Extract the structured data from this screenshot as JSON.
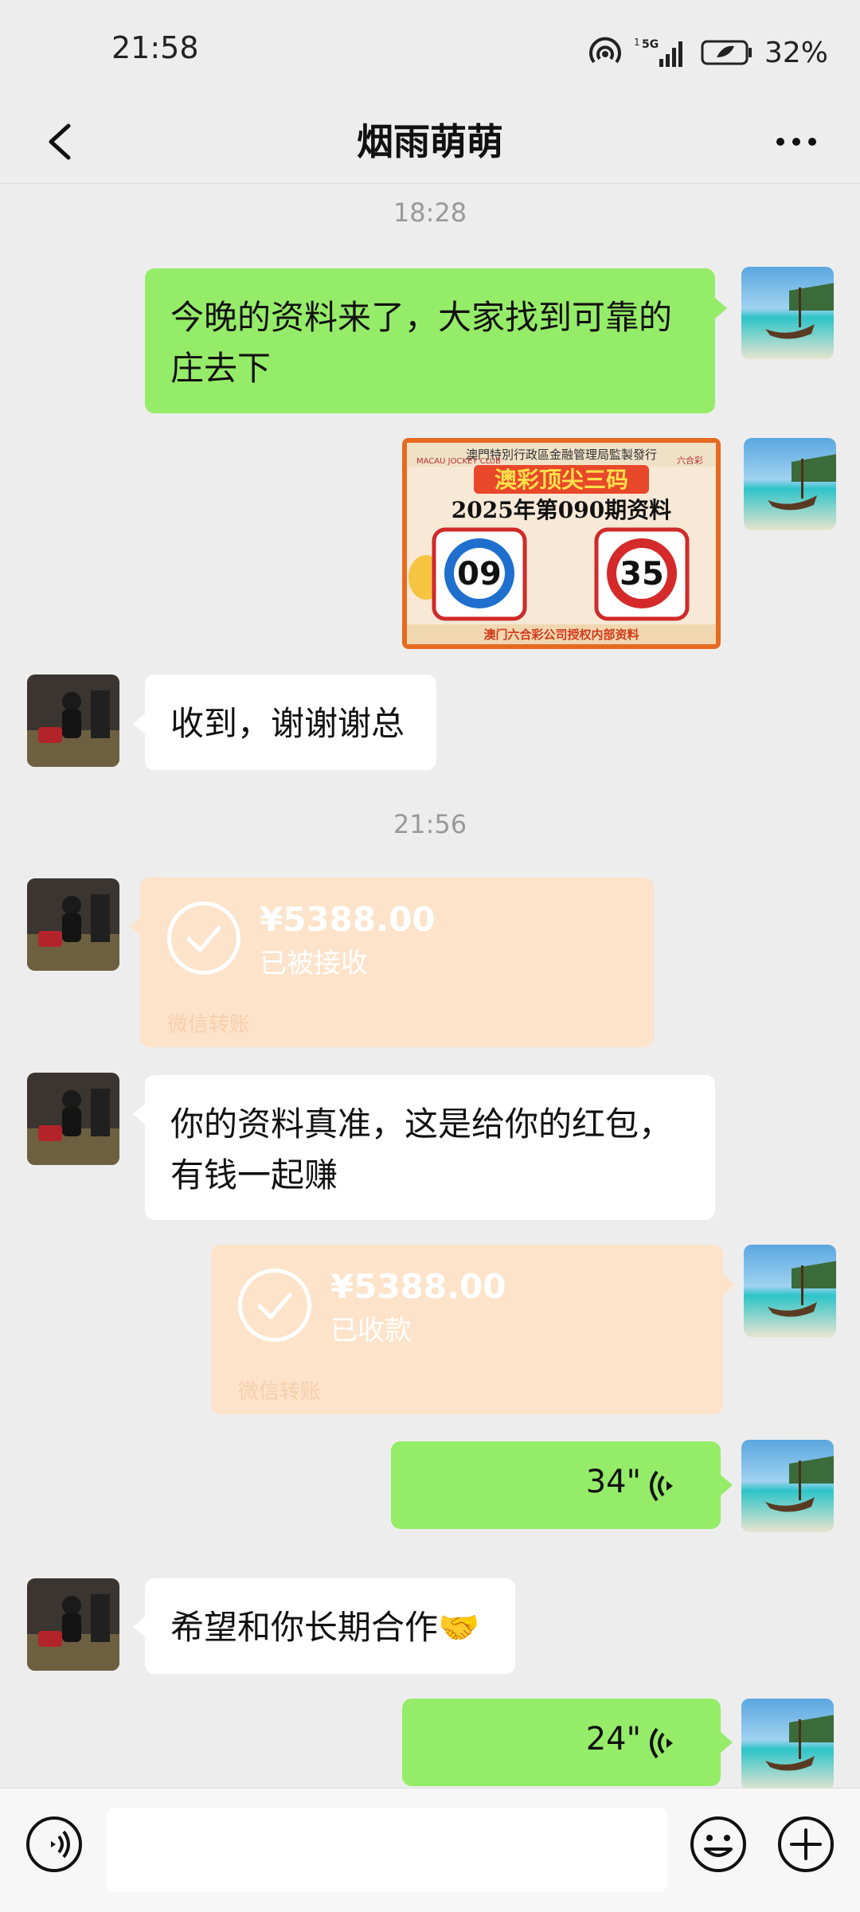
{
  "status_bar": {
    "time": "21:58",
    "battery": "32%",
    "signal_label": "5G",
    "sim_index": "1"
  },
  "header": {
    "title": "烟雨萌萌"
  },
  "timestamps": [
    "18:28",
    "21:56"
  ],
  "messages": {
    "m1_text": "今晚的资料来了，大家找到可靠的庄去下",
    "m3_text": "收到，谢谢谢总",
    "m4_amount": "¥5388.00",
    "m4_status": "已被接收",
    "m4_label": "微信转账",
    "m5_text": "你的资料真准，这是给你的红包，有钱一起赚",
    "m6_amount": "¥5388.00",
    "m6_status": "已收款",
    "m6_label": "微信转账",
    "m7_duration": "34\"",
    "m8_text": "希望和你长期合作🤝",
    "m9_duration": "24\""
  },
  "poster": {
    "top_line": "澳門特別行政區金融管理局監製發行",
    "brand": "澳彩顶尖三码",
    "period": "2025年第090期资料",
    "ball1": "09",
    "ball2": "35",
    "bottom_line": "澳门六合彩公司授权内部资料",
    "logo_text": "六合彩",
    "club_text": "MACAU JOCKEY CLUB"
  },
  "colors": {
    "green_bubble": "#95ec69",
    "transfer": "#fde3ca",
    "background": "#ededed"
  }
}
